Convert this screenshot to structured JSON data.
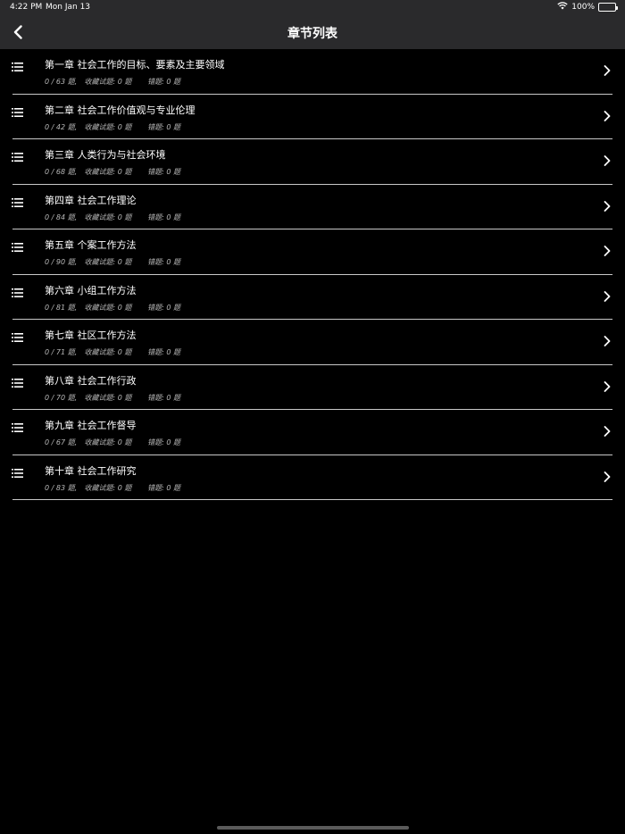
{
  "status_bar": {
    "time": "4:22 PM",
    "date": "Mon Jan 13",
    "battery": "100%"
  },
  "nav": {
    "title": "章节列表",
    "back_icon": "chevron-left-icon"
  },
  "chapters": [
    {
      "title": "第一章 社会工作的目标、要素及主要领域",
      "progress": "0 / 63 题,",
      "favorites": "收藏试题: 0 题",
      "wrong": "错题: 0 题"
    },
    {
      "title": "第二章 社会工作价值观与专业伦理",
      "progress": "0 / 42 题,",
      "favorites": "收藏试题: 0 题",
      "wrong": "错题: 0 题"
    },
    {
      "title": "第三章 人类行为与社会环境",
      "progress": "0 / 68 题,",
      "favorites": "收藏试题: 0 题",
      "wrong": "错题: 0 题"
    },
    {
      "title": "第四章 社会工作理论",
      "progress": "0 / 84 题,",
      "favorites": "收藏试题: 0 题",
      "wrong": "错题: 0 题"
    },
    {
      "title": "第五章 个案工作方法",
      "progress": "0 / 90 题,",
      "favorites": "收藏试题: 0 题",
      "wrong": "错题: 0 题"
    },
    {
      "title": "第六章 小组工作方法",
      "progress": "0 / 81 题,",
      "favorites": "收藏试题: 0 题",
      "wrong": "错题: 0 题"
    },
    {
      "title": "第七章 社区工作方法",
      "progress": "0 / 71 题,",
      "favorites": "收藏试题: 0 题",
      "wrong": "错题: 0 题"
    },
    {
      "title": "第八章 社会工作行政",
      "progress": "0 / 70 题,",
      "favorites": "收藏试题: 0 题",
      "wrong": "错题: 0 题"
    },
    {
      "title": "第九章 社会工作督导",
      "progress": "0 / 67 题,",
      "favorites": "收藏试题: 0 题",
      "wrong": "错题: 0 题"
    },
    {
      "title": "第十章 社会工作研究",
      "progress": "0 / 83 题,",
      "favorites": "收藏试题: 0 题",
      "wrong": "错题: 0 题"
    }
  ],
  "icons": {
    "row_leading": "list-icon",
    "row_trailing": "chevron-right-icon",
    "wifi": "wifi-icon",
    "battery": "battery-icon"
  },
  "colors": {
    "background": "#000000",
    "bar_background": "#2a2a2c",
    "separator": "#c8c8c8",
    "meta_text": "#b8b8b8"
  }
}
